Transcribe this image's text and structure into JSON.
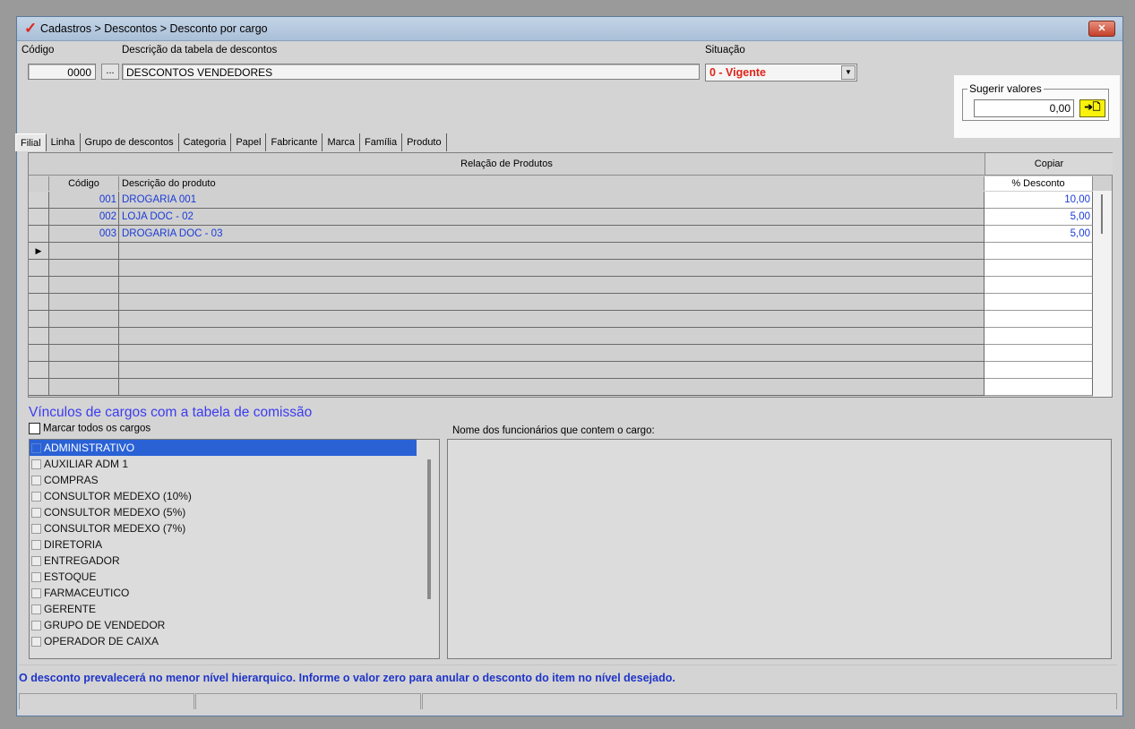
{
  "window": {
    "title": "Cadastros > Descontos > Desconto por cargo",
    "close_label": "✕"
  },
  "header": {
    "code_label": "Código",
    "code_value": "0000",
    "code_lookup_label": "...",
    "desc_label": "Descrição da tabela de descontos",
    "desc_value": "DESCONTOS VENDEDORES",
    "status_label": "Situação",
    "status_value": "0 - Vigente"
  },
  "suggest": {
    "title": "Sugerir valores",
    "value": "0,00",
    "button_label": "➔🗋"
  },
  "tabs": [
    "Filial",
    "Linha",
    "Grupo de descontos",
    "Categoria",
    "Papel",
    "Fabricante",
    "Marca",
    "Família",
    "Produto"
  ],
  "grid": {
    "title": "Relação de Produtos",
    "copy_label": "Copiar",
    "col_code": "Código",
    "col_desc": "Descrição do produto",
    "col_pct": "% Desconto",
    "rows": [
      {
        "code": "001",
        "desc": "DROGARIA 001",
        "pct": "10,00"
      },
      {
        "code": "002",
        "desc": "LOJA  DOC - 02",
        "pct": "5,00"
      },
      {
        "code": "003",
        "desc": "DROGARIA DOC - 03",
        "pct": "5,00"
      }
    ],
    "current_row_marker": "▶"
  },
  "roles": {
    "section_title": "Vínculos de cargos com a tabela de comissão",
    "mark_all_label": "Marcar todos os cargos",
    "employees_label": "Nome dos funcionários que contem o cargo:",
    "items": [
      "ADMINISTRATIVO",
      "AUXILIAR ADM 1",
      "COMPRAS",
      "CONSULTOR MEDEXO (10%)",
      "CONSULTOR MEDEXO (5%)",
      "CONSULTOR MEDEXO (7%)",
      "DIRETORIA",
      "ENTREGADOR",
      "ESTOQUE",
      "FARMACEUTICO",
      "GERENTE",
      "GRUPO DE VENDEDOR",
      "OPERADOR DE CAIXA"
    ]
  },
  "footer": {
    "note": "O desconto prevalecerá no menor nível hierarquico. Informe o valor zero para anular o desconto do item no nível desejado."
  }
}
